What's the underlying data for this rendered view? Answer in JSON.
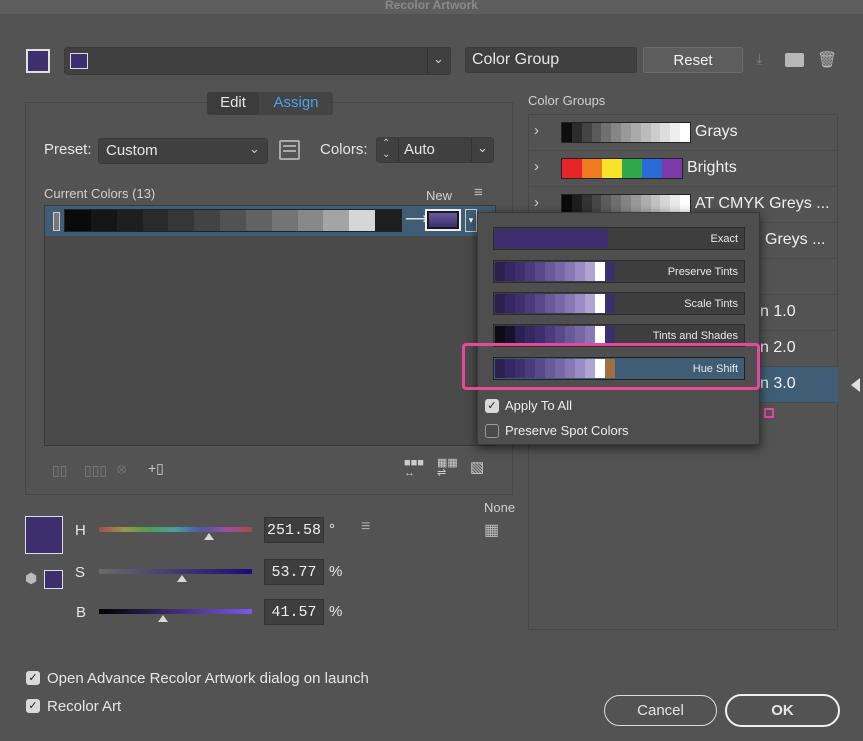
{
  "window": {
    "title": "Recolor Artwork"
  },
  "toolbar": {
    "group_name_value": "Color Group",
    "reset_label": "Reset"
  },
  "tabs": {
    "edit": "Edit",
    "assign": "Assign"
  },
  "preset": {
    "label": "Preset:",
    "value": "Custom"
  },
  "colors": {
    "label": "Colors:",
    "value": "Auto"
  },
  "current_colors": {
    "label": "Current Colors (13)",
    "new_label": "New",
    "swatches": [
      "#0a0a0a",
      "#151515",
      "#1f1f1f",
      "#2a2a2a",
      "#363636",
      "#434343",
      "#525252",
      "#626262",
      "#747474",
      "#888888",
      "#a4a4a4",
      "#d6d6d6",
      "#1e1e1e"
    ]
  },
  "color_groups": {
    "label": "Color Groups",
    "items": [
      {
        "name": "Grays"
      },
      {
        "name": "Brights"
      },
      {
        "name": "AT CMYK Greys ..."
      },
      {
        "name": "Greys ..."
      },
      {
        "name": "n 1.0"
      },
      {
        "name": "n 2.0"
      },
      {
        "name": "n 3.0"
      }
    ]
  },
  "popup": {
    "options": [
      {
        "label": "Exact"
      },
      {
        "label": "Preserve Tints"
      },
      {
        "label": "Scale Tints"
      },
      {
        "label": "Tints and Shades"
      },
      {
        "label": "Hue Shift"
      }
    ],
    "apply_to_all": "Apply To All",
    "preserve_spot": "Preserve Spot Colors"
  },
  "hsb": {
    "h_label": "H",
    "h_value": "251.58",
    "h_unit": "°",
    "h_level": 0.72,
    "s_label": "S",
    "s_value": "53.77",
    "s_unit": "%",
    "s_level": 0.54,
    "b_label": "B",
    "b_value": "41.57",
    "b_unit": "%",
    "b_level": 0.42
  },
  "none_label": "None",
  "footer": {
    "open_advance": "Open Advance Recolor Artwork dialog on launch",
    "recolor_art": "Recolor Art",
    "cancel": "Cancel",
    "ok": "OK"
  },
  "colors_theme": {
    "base_purple": "#3d2f6e",
    "accent_blue": "#4aa3e8",
    "highlight_pink": "#e8479a",
    "selected_row": "#3f5e76"
  }
}
